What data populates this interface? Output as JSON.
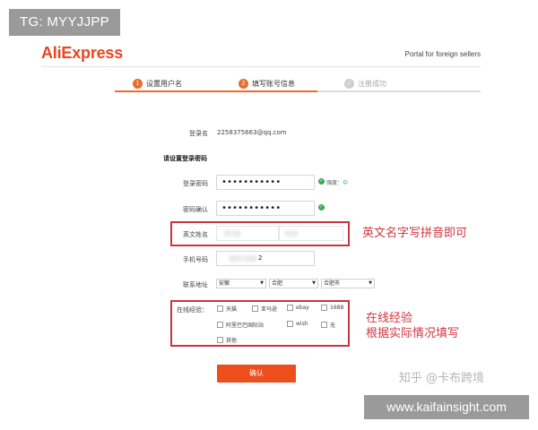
{
  "overlay": {
    "tag": "TG: MYYJJPP",
    "site": "www.kaifainsight.com",
    "watermark": "知乎 @卡布跨境"
  },
  "header": {
    "logo": "AliExpress",
    "portal_text": "Portal for foreign sellers"
  },
  "steps": [
    {
      "num": "1",
      "label": "设置用户名",
      "state": "active"
    },
    {
      "num": "2",
      "label": "填写账号信息",
      "state": "active"
    },
    {
      "num": "",
      "label": "注册成功",
      "state": "pending"
    }
  ],
  "form": {
    "login_name_label": "登录名",
    "login_name_value": "2258375663@qq.com",
    "password_section": "请设置登录密码",
    "password_label": "登录密码",
    "password_value": "•••••••••••",
    "strength_label": "强度：",
    "strength_value": "中",
    "confirm_label": "密码确认",
    "confirm_value": "•••••••••••",
    "english_name_label": "英文姓名",
    "phone_label": "手机号码",
    "phone_suffix": "2",
    "address_label": "联系地址",
    "address": {
      "province": "安徽",
      "city": "合肥",
      "district": "合肥市"
    },
    "experience_label": "在线经验：",
    "experience_options": [
      "天猫",
      "亚马逊",
      "ebay",
      "1688",
      "阿里巴巴国际站",
      "wish",
      "无",
      "其他"
    ],
    "confirm_button": "确认"
  },
  "annotations": {
    "english_name_note": "英文名字写拼音即可",
    "experience_note_1": "在线经验",
    "experience_note_2": "根据实际情况填写"
  },
  "colors": {
    "brand": "#e8461f",
    "step_active": "#ee6a2d",
    "annotation": "#d0373f",
    "button": "#ee4e1b"
  }
}
